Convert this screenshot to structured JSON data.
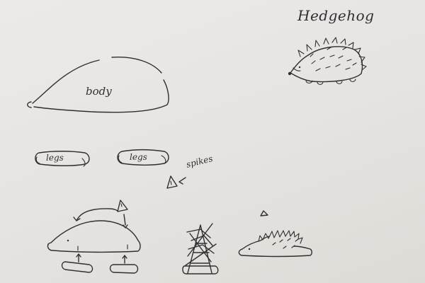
{
  "title": "Hedgehog",
  "labels": {
    "body": "body",
    "legs_1": "legs",
    "legs_2": "legs",
    "spikes": "spikes"
  }
}
